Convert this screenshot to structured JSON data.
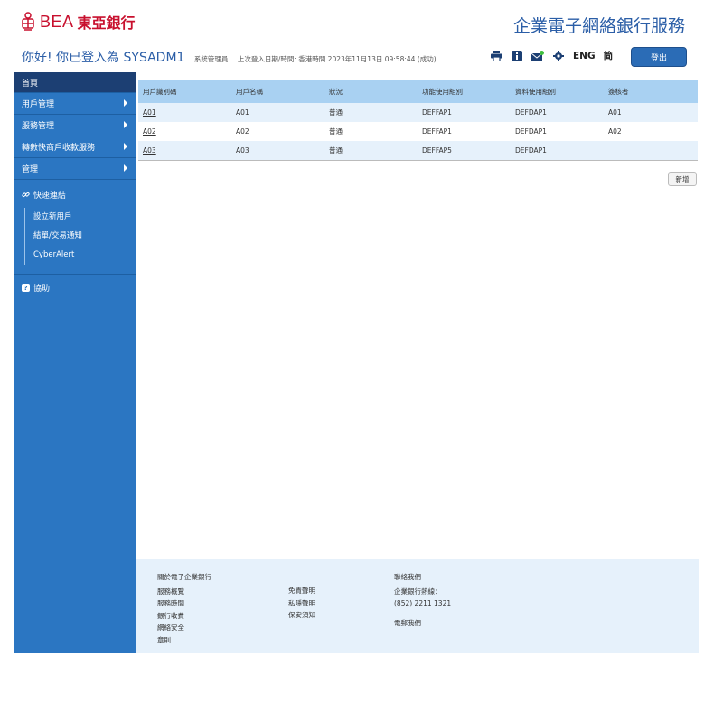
{
  "header": {
    "logo_en": "BEA",
    "logo_cn": "東亞銀行",
    "service_title": "企業電子網絡銀行服務",
    "brand_color": "#c8102e",
    "accent_color": "#2b5ea7"
  },
  "welcome": {
    "greeting": "你好! 你已登入為 SYSADM1",
    "role": "系統管理員",
    "last_login": "上次登入日期/時間: 香港時間 2023年11月13日 09:58:44 (成功)"
  },
  "toolbar": {
    "icons": [
      "print-icon",
      "info-icon",
      "mail-icon",
      "gear-icon"
    ],
    "lang_en": "ENG",
    "lang_sc": "简",
    "logout_label": "登出"
  },
  "sidebar": {
    "items": [
      {
        "label": "首頁",
        "arrow": false
      },
      {
        "label": "用戶管理",
        "arrow": true
      },
      {
        "label": "服務管理",
        "arrow": true
      },
      {
        "label": "轉數快商戶收款服務",
        "arrow": true
      },
      {
        "label": "管理",
        "arrow": true
      }
    ],
    "quick_links_title": "快速連結",
    "quick_links": [
      "設立新用戶",
      "結單/交易通知",
      "CyberAlert"
    ],
    "help_label": "協助"
  },
  "table": {
    "columns": [
      "用戶識別碼",
      "用戶名稱",
      "狀況",
      "功能使用組別",
      "資料使用組別",
      "簽核者"
    ],
    "rows": [
      [
        "A01",
        "A01",
        "普通",
        "DEFFAP1",
        "DEFDAP1",
        "A01"
      ],
      [
        "A02",
        "A02",
        "普通",
        "DEFFAP1",
        "DEFDAP1",
        "A02"
      ],
      [
        "A03",
        "A03",
        "普通",
        "DEFFAP5",
        "DEFDAP1",
        ""
      ]
    ],
    "add_label": "新增"
  },
  "footer": {
    "col1_title": "關於電子企業銀行",
    "col1_links": [
      "服務概覽",
      "服務時間",
      "銀行收費",
      "網絡安全",
      "章則"
    ],
    "col2_links": [
      "免責聲明",
      "私隱聲明",
      "保安須知"
    ],
    "col3_title": "聯絡我們",
    "hotline_label": "企業銀行熱線：",
    "hotline_number": "(852) 2211 1321",
    "email_label": "電郵我們"
  }
}
